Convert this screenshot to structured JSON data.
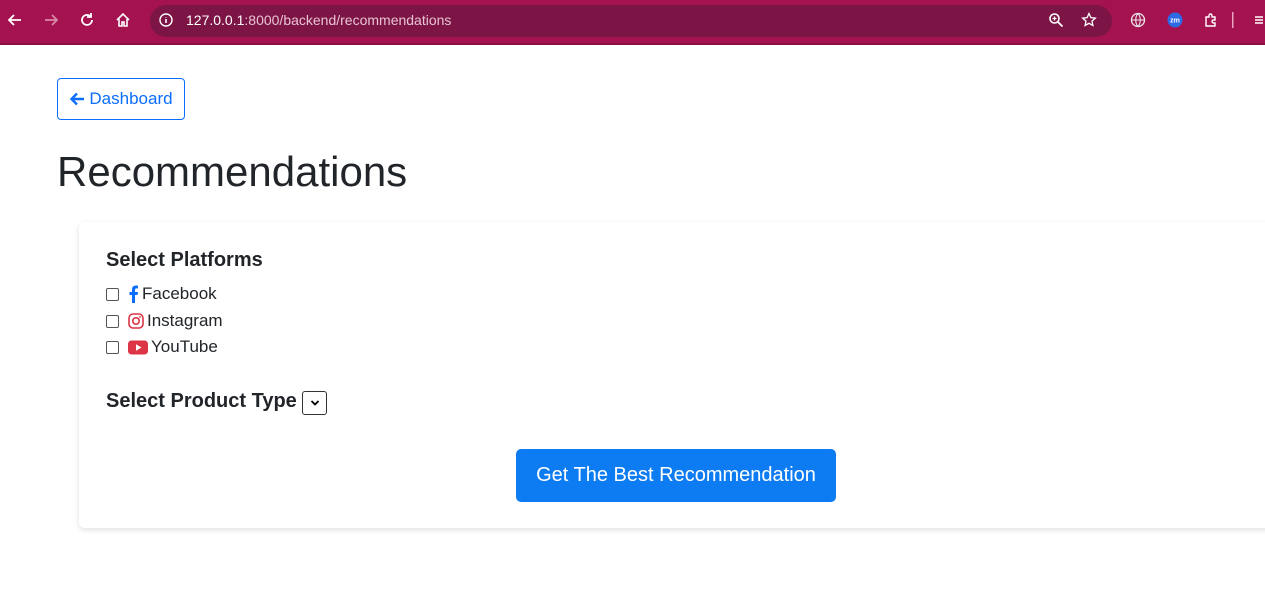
{
  "browser": {
    "url_host": "127.0.0.1",
    "url_path": ":8000/backend/recommendations"
  },
  "page": {
    "back_label": "Dashboard",
    "title": "Recommendations",
    "platforms_heading": "Select Platforms",
    "platforms": [
      {
        "label": "Facebook",
        "icon": "facebook-icon",
        "color": "#0d6efd",
        "checked": false
      },
      {
        "label": "Instagram",
        "icon": "instagram-icon",
        "color": "#dc3545",
        "checked": false
      },
      {
        "label": "YouTube",
        "icon": "youtube-icon",
        "color": "#dc3545",
        "checked": false
      }
    ],
    "product_type_heading": "Select Product Type",
    "product_type_value": "",
    "submit_label": "Get The Best Recommendation"
  },
  "colors": {
    "chrome": "#a4134f",
    "primary": "#0d7cf2"
  }
}
